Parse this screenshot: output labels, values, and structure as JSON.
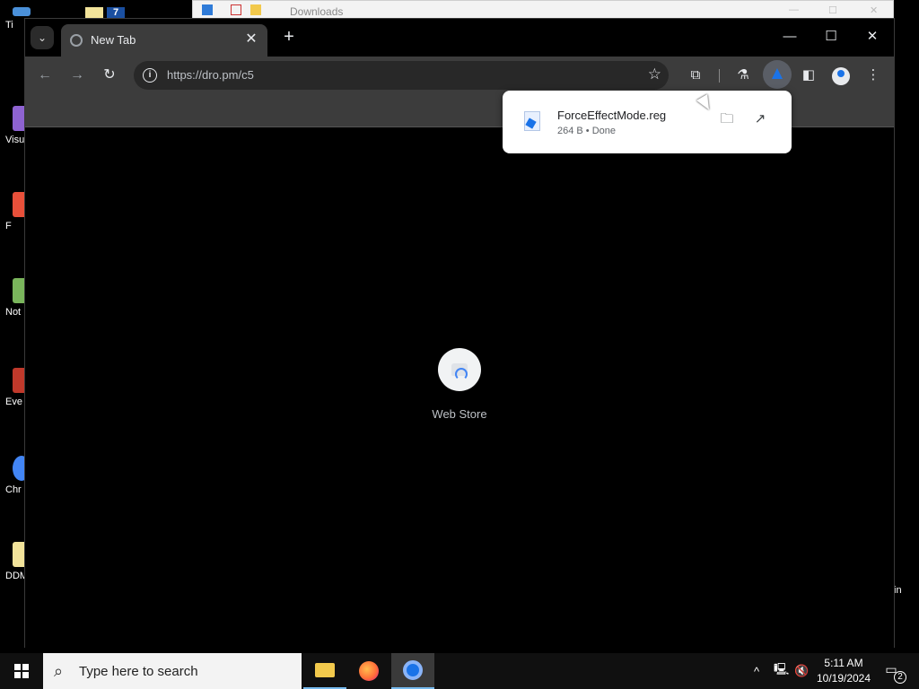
{
  "desktop": {
    "icons": [
      {
        "label": "Ti",
        "color": "#4a90d9"
      },
      {
        "label": "Visu",
        "color": "#8e63d1"
      },
      {
        "label": "F",
        "color": "#e8503a"
      },
      {
        "label": "Not",
        "color": "#7ab55c"
      },
      {
        "label": "Eve",
        "color": "#c0392b"
      },
      {
        "label": "Chr",
        "color": "#4285f4"
      },
      {
        "label": "DDM",
        "color": "#f2e39a"
      }
    ],
    "right_label": "in"
  },
  "explorer": {
    "title": "Downloads"
  },
  "browser": {
    "tab": {
      "title": "New Tab",
      "close": "✕"
    },
    "new_tab": "+",
    "window_controls": {
      "minimize": "—",
      "maximize": "☐",
      "close": "✕"
    },
    "toolbar": {
      "back": "←",
      "forward": "→",
      "reload": "↻",
      "url": "https://dro.pm/c5",
      "bookmark_star": "☆",
      "extensions": "⧉",
      "labs": "⚗",
      "sidepanel": "◧",
      "menu": "⋮"
    },
    "shortcut": {
      "label": "Web Store"
    },
    "download_bubble": {
      "file_name": "ForceEffectMode.reg",
      "meta": "264 B • Done",
      "show_in_folder": "🗀",
      "open": "↗"
    }
  },
  "taskbar": {
    "search_placeholder": "Type here to search",
    "clock_time": "5:11 AM",
    "clock_date": "10/19/2024",
    "notification_count": "2",
    "tray_chevron": "^",
    "network": "🖳",
    "volume": "🔇"
  }
}
